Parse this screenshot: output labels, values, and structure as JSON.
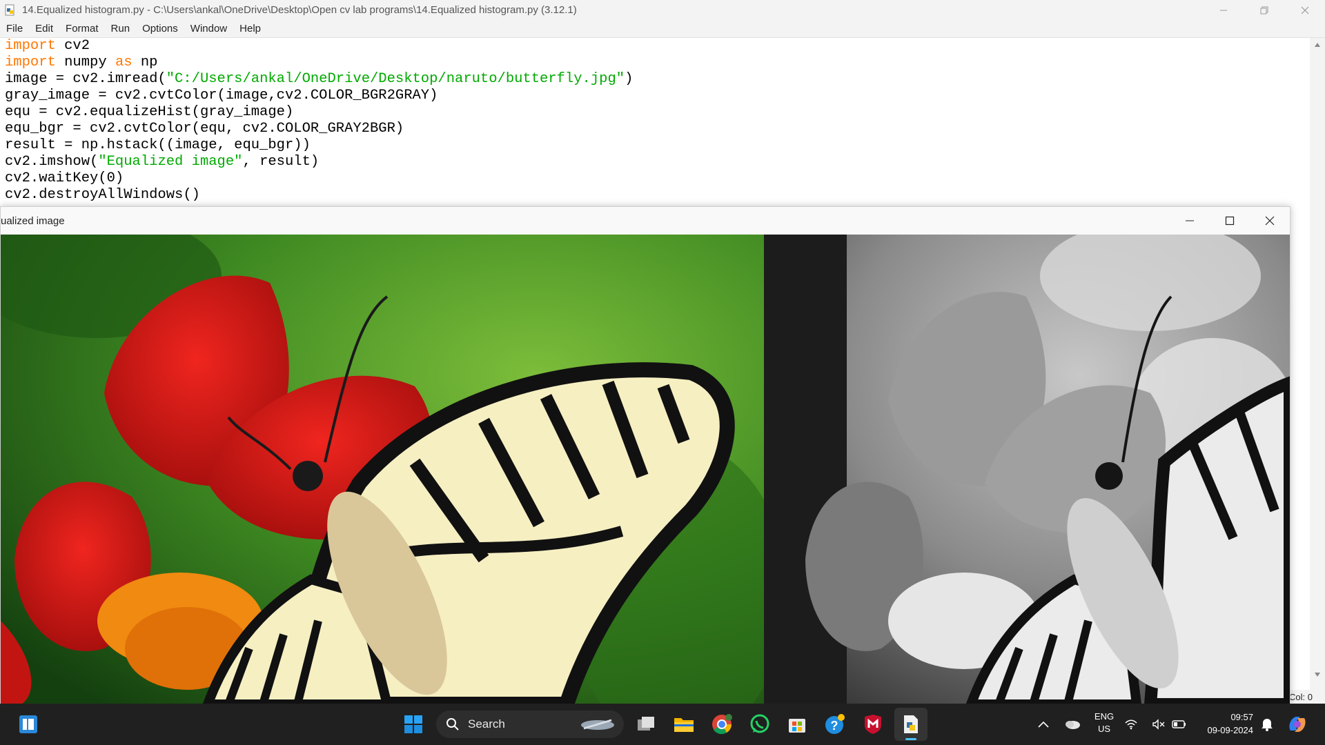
{
  "idle": {
    "title": "14.Equalized histogram.py - C:\\Users\\ankal\\OneDrive\\Desktop\\Open cv lab programs\\14.Equalized histogram.py (3.12.1)",
    "menu": [
      "File",
      "Edit",
      "Format",
      "Run",
      "Options",
      "Window",
      "Help"
    ],
    "code": [
      [
        {
          "t": "import",
          "c": "kw"
        },
        {
          "t": " cv2",
          "c": ""
        }
      ],
      [
        {
          "t": "import",
          "c": "kw"
        },
        {
          "t": " numpy ",
          "c": ""
        },
        {
          "t": "as",
          "c": "kw"
        },
        {
          "t": " np",
          "c": ""
        }
      ],
      [
        {
          "t": "image = cv2.imread(",
          "c": ""
        },
        {
          "t": "\"C:/Users/ankal/OneDrive/Desktop/naruto/butterfly.jpg\"",
          "c": "str"
        },
        {
          "t": ")",
          "c": ""
        }
      ],
      [
        {
          "t": "gray_image = cv2.cvtColor(image,cv2.COLOR_BGR2GRAY)",
          "c": ""
        }
      ],
      [
        {
          "t": "equ = cv2.equalizeHist(gray_image)",
          "c": ""
        }
      ],
      [
        {
          "t": "equ_bgr = cv2.cvtColor(equ, cv2.COLOR_GRAY2BGR)",
          "c": ""
        }
      ],
      [
        {
          "t": "result = np.hstack((image, equ_bgr))",
          "c": ""
        }
      ],
      [
        {
          "t": "cv2.imshow(",
          "c": ""
        },
        {
          "t": "\"Equalized image\"",
          "c": "str"
        },
        {
          "t": ", result)",
          "c": ""
        }
      ],
      [
        {
          "t": "cv2.waitKey(0)",
          "c": ""
        }
      ],
      [
        {
          "t": "cv2.destroyAllWindows()",
          "c": ""
        }
      ]
    ],
    "status": "Col: 0"
  },
  "imshow": {
    "title": "ualized image"
  },
  "taskbar": {
    "search_label": "Search",
    "lang_line1": "ENG",
    "lang_line2": "US",
    "time": "09:57",
    "date": "09-09-2024",
    "icons": [
      "start-icon",
      "search-icon",
      "task-view-icon",
      "file-explorer-icon",
      "chrome-icon",
      "whatsapp-icon",
      "microsoft-store-icon",
      "help-icon",
      "mcafee-icon",
      "python-idle-icon"
    ]
  },
  "colors": {
    "keyword": "#ff7700",
    "string": "#00aa00",
    "taskbar": "#202020",
    "accent": "#0078d4"
  }
}
